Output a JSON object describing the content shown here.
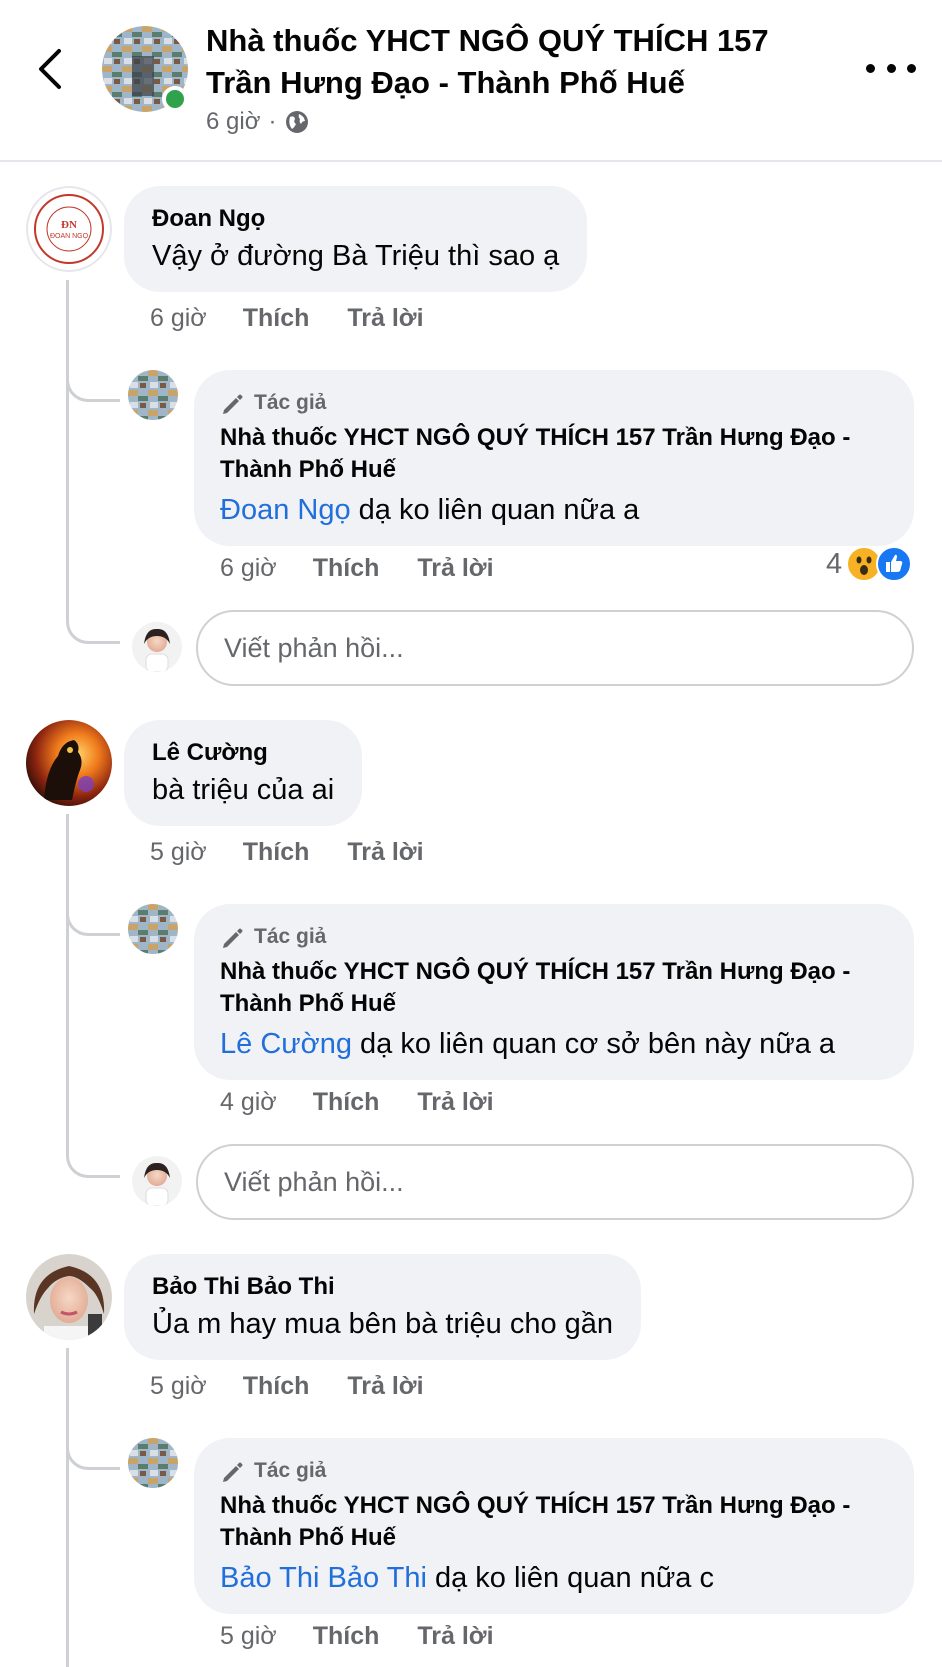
{
  "header": {
    "title": "Nhà thuốc YHCT NGÔ QUÝ THÍCH  157 Trần Hưng Đạo - Thành Phố Huế",
    "time": "6 giờ",
    "separator": "·"
  },
  "labels": {
    "like": "Thích",
    "reply": "Trả lời",
    "author_badge": "Tác giả",
    "write_reply_placeholder": "Viết phản hồi..."
  },
  "comments": [
    {
      "name": "Đoan Ngọ",
      "text": "Vậy ở đường Bà Triệu thì sao ạ",
      "time": "6 giờ",
      "avatar_text": "ĐOAN NGỌ",
      "reply": {
        "name": "Nhà thuốc YHCT NGÔ QUÝ THÍCH  157 Trần Hưng Đạo - Thành Phố Huế",
        "mention": "Đoan Ngọ",
        "text": " dạ ko liên quan nữa a",
        "time": "6 giờ",
        "reaction_count": "4"
      }
    },
    {
      "name": "Lê Cường",
      "text": "bà triệu của ai",
      "time": "5 giờ",
      "reply": {
        "name": "Nhà thuốc YHCT NGÔ QUÝ THÍCH  157 Trần Hưng Đạo - Thành Phố Huế",
        "mention": "Lê Cường",
        "text": " dạ ko liên quan cơ sở bên này nữa a",
        "time": "4 giờ"
      }
    },
    {
      "name": "Bảo Thi Bảo Thi",
      "text": "Ủa m hay mua bên bà triệu cho gần",
      "time": "5 giờ",
      "reply": {
        "name": "Nhà thuốc YHCT NGÔ QUÝ THÍCH  157 Trần Hưng Đạo - Thành Phố Huế",
        "mention": "Bảo Thi Bảo Thi",
        "text": " dạ ko liên quan nữa c",
        "time": "5 giờ"
      }
    }
  ],
  "colors": {
    "mention": "#216fdb",
    "bubble": "#f0f2f5",
    "online": "#31a24c"
  }
}
